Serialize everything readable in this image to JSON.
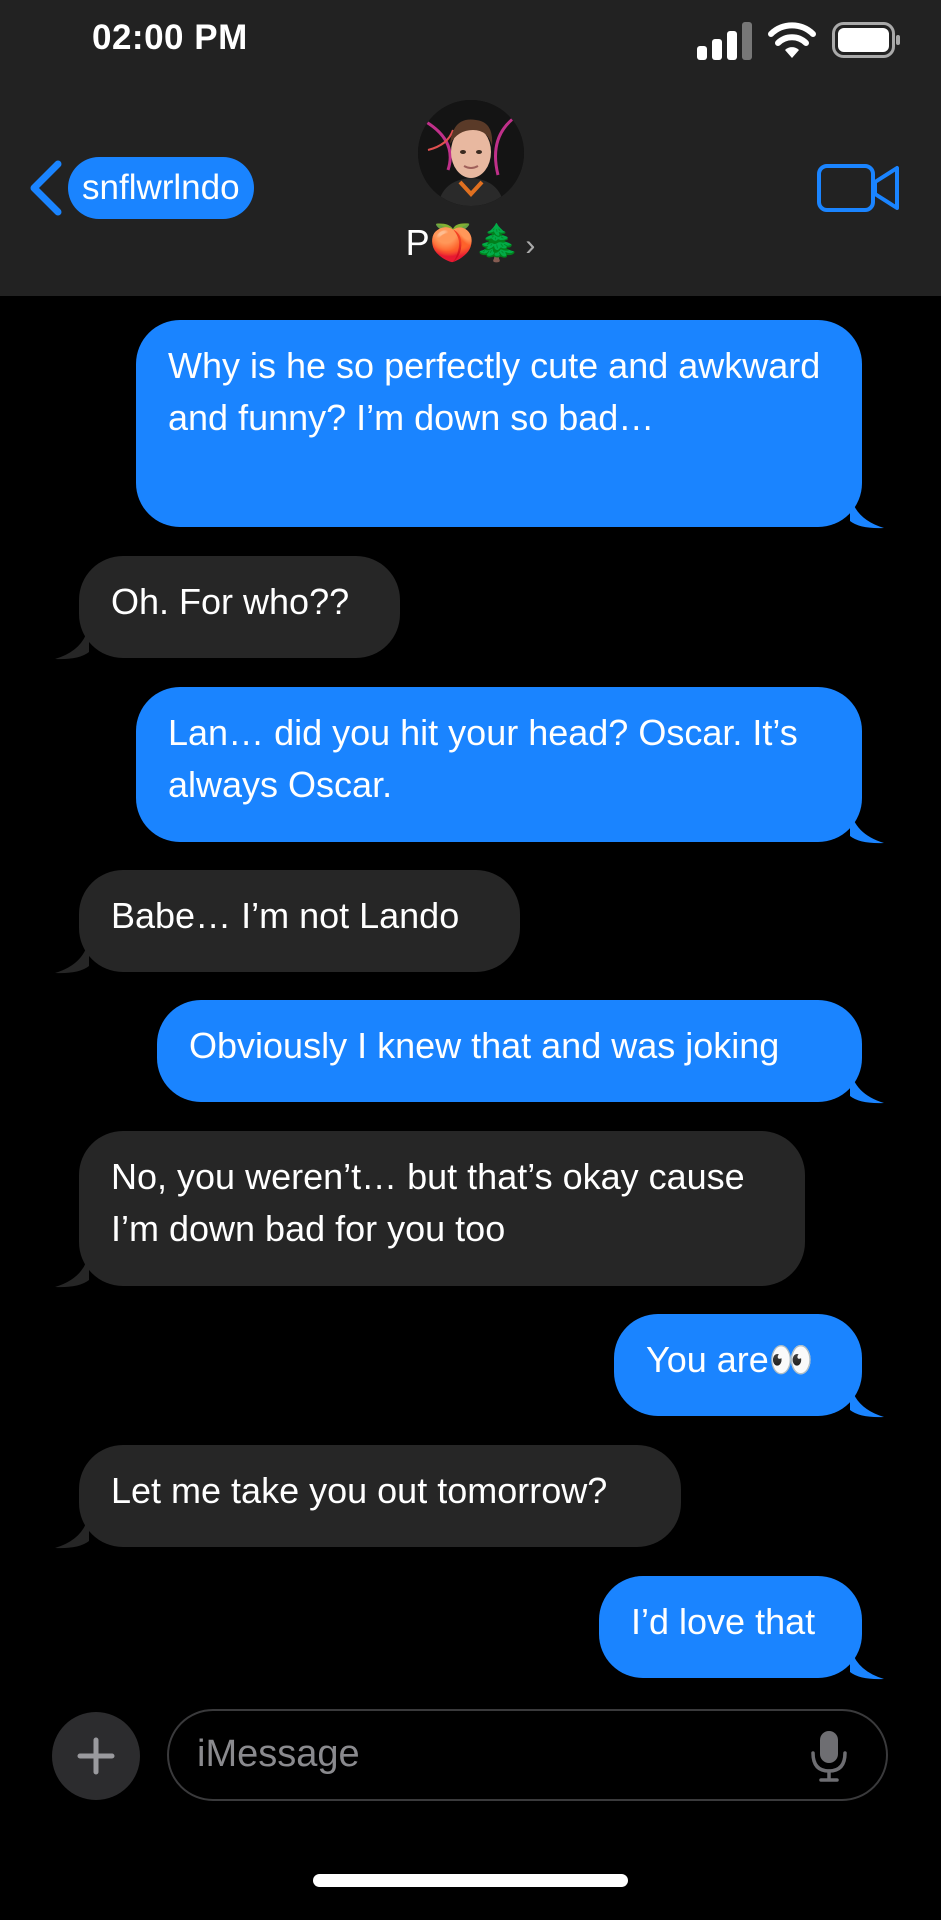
{
  "status_bar": {
    "time": "02:00 PM"
  },
  "header": {
    "back_label": "snflwrlndo",
    "contact_name": "P🍑🌲",
    "contact_chevron": "›",
    "icons": [
      "chevron-left-icon",
      "video-camera-icon"
    ],
    "accent_color": "#1a84ff"
  },
  "messages": [
    {
      "from": "me",
      "text": "Why is he so perfectly cute and awkward and funny? I’m down so bad…"
    },
    {
      "from": "them",
      "text": "Oh. For who??"
    },
    {
      "from": "me",
      "text": "Lan… did you hit your head? Oscar. It’s always Oscar."
    },
    {
      "from": "them",
      "text": "Babe… I’m not Lando"
    },
    {
      "from": "me",
      "text": "Obviously I knew that and was joking"
    },
    {
      "from": "them",
      "text": "No, you weren’t… but that’s okay cause I’m down bad for you too"
    },
    {
      "from": "me",
      "text": "You are👀"
    },
    {
      "from": "them",
      "text": "Let me take you out tomorrow?"
    },
    {
      "from": "me",
      "text": "I’d love that"
    }
  ],
  "composer": {
    "placeholder": "iMessage",
    "icons": [
      "plus-icon",
      "microphone-icon"
    ]
  }
}
